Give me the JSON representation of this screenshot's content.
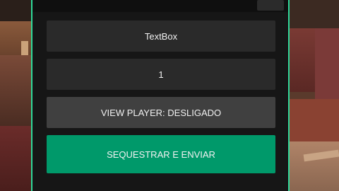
{
  "panel": {
    "accent_color": "#2fd99a",
    "textbox_label": "TextBox",
    "number_value": "1",
    "toggle_label": "VIEW PLAYER: DESLIGADO",
    "action_label": "SEQUESTRAR E ENVIAR",
    "action_color": "#00996a"
  }
}
